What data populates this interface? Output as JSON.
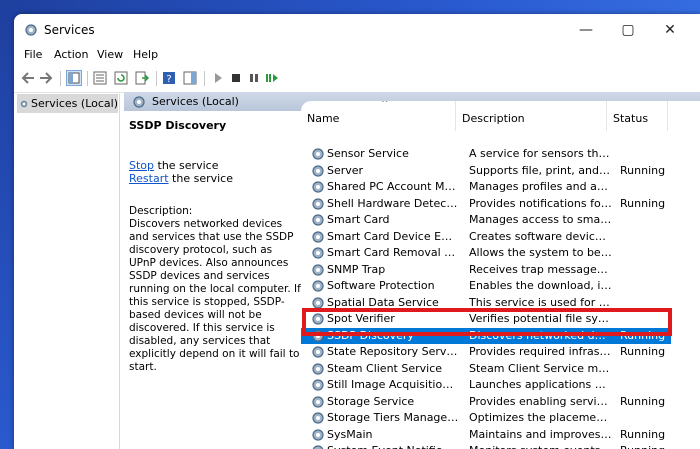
{
  "window": {
    "title": "Services"
  },
  "menu": [
    "File",
    "Action",
    "View",
    "Help"
  ],
  "tree": {
    "root_label": "Services (Local)"
  },
  "pane": {
    "header": "Services (Local)"
  },
  "detail": {
    "service_name": "SSDP Discovery",
    "stop_link": "Stop",
    "stop_suffix": " the service",
    "restart_link": "Restart",
    "restart_suffix": " the service",
    "description_label": "Description:",
    "description": "Discovers networked devices and services that use the SSDP discovery protocol, such as UPnP devices. Also announces SSDP devices and services running on the local computer. If this service is stopped, SSDP-based devices will not be discovered. If this service is disabled, any services that explicitly depend on it will fail to start."
  },
  "list": {
    "columns": [
      "Name",
      "Description",
      "Status"
    ],
    "rows": [
      {
        "name": "Sensor Service",
        "description": "A service for sensors that ma...",
        "status": ""
      },
      {
        "name": "Server",
        "description": "Supports file, print, and nam...",
        "status": "Running"
      },
      {
        "name": "Shared PC Account Manager",
        "description": "Manages profiles and accou...",
        "status": ""
      },
      {
        "name": "Shell Hardware Detection",
        "description": "Provides notifications for Aut...",
        "status": "Running"
      },
      {
        "name": "Smart Card",
        "description": "Manages access to smart car...",
        "status": ""
      },
      {
        "name": "Smart Card Device Enumera...",
        "description": "Creates software device node...",
        "status": ""
      },
      {
        "name": "Smart Card Removal Policy",
        "description": "Allows the system to be conf...",
        "status": ""
      },
      {
        "name": "SNMP Trap",
        "description": "Receives trap messages gene...",
        "status": ""
      },
      {
        "name": "Software Protection",
        "description": "Enables the download, install...",
        "status": ""
      },
      {
        "name": "Spatial Data Service",
        "description": "This service is used for Spatia...",
        "status": ""
      },
      {
        "name": "Spot Verifier",
        "description": "Verifies potential file system...",
        "status": ""
      },
      {
        "name": "SSDP Discovery",
        "description": "Discovers networked devices ...",
        "status": "Running"
      },
      {
        "name": "State Repository Service",
        "description": "Provides required infrastruct...",
        "status": "Running"
      },
      {
        "name": "Steam Client Service",
        "description": "Steam Client Service monitor...",
        "status": ""
      },
      {
        "name": "Still Image Acquisition Events",
        "description": "Launches applications associ...",
        "status": ""
      },
      {
        "name": "Storage Service",
        "description": "Provides enabling services fo...",
        "status": "Running"
      },
      {
        "name": "Storage Tiers Management",
        "description": "Optimizes the placement of ...",
        "status": ""
      },
      {
        "name": "SysMain",
        "description": "Maintains and improves syst...",
        "status": "Running"
      },
      {
        "name": "System Event Notification S...",
        "description": "Monitors system events and ...",
        "status": "Running"
      }
    ]
  },
  "colors": {
    "selection": "#0078d7",
    "highlight": "#e0191d",
    "link": "#1155cc"
  }
}
